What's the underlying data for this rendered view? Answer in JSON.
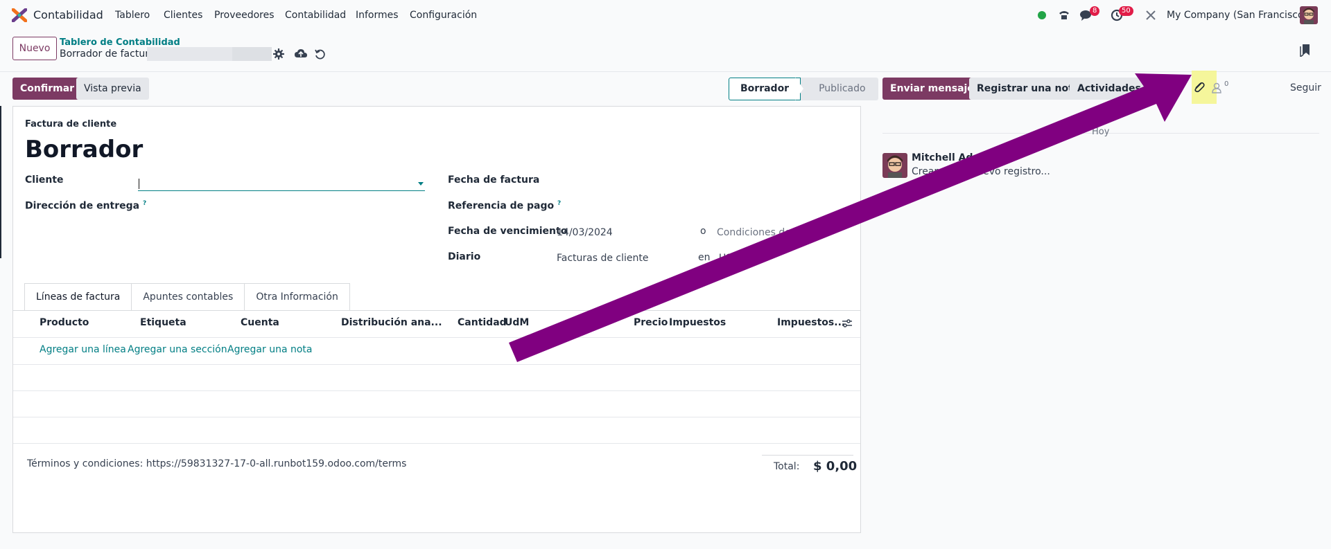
{
  "nav": {
    "app_name": "Contabilidad",
    "menu": [
      "Tablero",
      "Clientes",
      "Proveedores",
      "Contabilidad",
      "Informes",
      "Configuración"
    ],
    "badge_messages": "8",
    "badge_activities": "50",
    "company": "My Company (San Francisco)"
  },
  "control_panel": {
    "new_label": "Nuevo",
    "breadcrumb_parent": "Tablero de Contabilidad",
    "breadcrumb_current": "Borrador de factura"
  },
  "actions": {
    "confirm": "Confirmar",
    "preview": "Vista previa"
  },
  "statusbar": {
    "current": "Borrador",
    "next": "Publicado"
  },
  "form": {
    "doc_type": "Factura de cliente",
    "title": "Borrador",
    "fields": {
      "cliente": "Cliente",
      "direccion": "Dirección de entrega",
      "fecha_factura": "Fecha de factura",
      "referencia": "Referencia de pago",
      "fecha_venc": "Fecha de vencimiento",
      "fecha_venc_val": "14/03/2024",
      "o": "o",
      "condiciones": "Condiciones de pa",
      "diario": "Diario",
      "diario_val": "Facturas de cliente",
      "en": "en",
      "moneda": "USD"
    },
    "tabs": [
      "Líneas de factura",
      "Apuntes contables",
      "Otra Información"
    ],
    "columns": [
      "Producto",
      "Etiqueta",
      "Cuenta",
      "Distribución ana...",
      "Cantidad",
      "UdM",
      "Precio",
      "Impuestos",
      "Impuestos..."
    ],
    "add_links": [
      "Agregar una línea",
      "Agregar una sección",
      "Agregar una nota"
    ],
    "terms": "Términos y condiciones: https://59831327-17-0-all.runbot159.odoo.com/terms",
    "total_label": "Total:",
    "total_value": "$ 0,00"
  },
  "chatter": {
    "send": "Enviar mensaje",
    "note": "Registrar una nota",
    "activities": "Actividades",
    "followers_count": "0",
    "follow": "Seguir",
    "date": "Hoy",
    "author": "Mitchell Admin",
    "body": "Creando un nuevo registro..."
  },
  "colors": {
    "brand": "#7c3a63",
    "link": "#017e84",
    "annotation_arrow": "#800080",
    "highlight": "#f4f58a"
  }
}
